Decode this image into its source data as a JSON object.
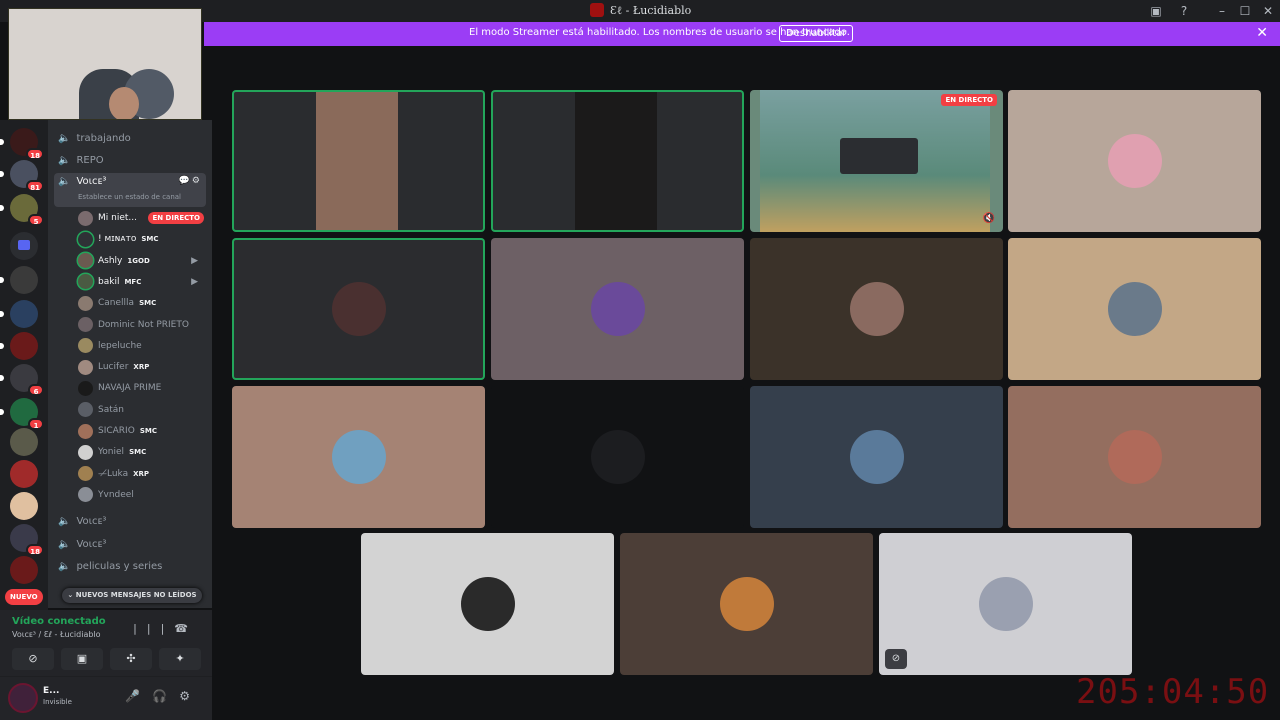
{
  "window": {
    "title": "Ɛℓ - Łucidiablo"
  },
  "banner": {
    "message": "El modo Streamer está habilitado. Los nombres de usuario se han truncado.",
    "button": "Deshabilitar"
  },
  "servers": {
    "badges": [
      "18",
      "81",
      "5",
      "6",
      "1",
      "18"
    ],
    "new_label": "NUEVO"
  },
  "channels": {
    "items": [
      {
        "label": "trabajando"
      },
      {
        "label": "REPO"
      }
    ],
    "active": {
      "label": "Voιcᴇ³",
      "status": "Establece un estado de canal"
    },
    "after": [
      {
        "label": "Voιcᴇ³"
      },
      {
        "label": "Voιcᴇ³"
      },
      {
        "label": "peliculas y series"
      }
    ],
    "members": [
      {
        "name": "Mi niet...",
        "tag": "",
        "live": "EN DIRECTO",
        "color": "#7a6b6e",
        "speaking": false
      },
      {
        "name": "! ᴍɪɴᴀᴛᴏ",
        "tag": "SMC",
        "color": "#2f3136",
        "speaking": true
      },
      {
        "name": "Ashly",
        "tag": "1GOD",
        "color": "#6b5a50",
        "speaking": true
      },
      {
        "name": "bakil",
        "tag": "MFC",
        "color": "#4a5a42",
        "speaking": true
      },
      {
        "name": "Canellla",
        "tag": "SMC",
        "color": "#8a7a70",
        "speaking": false
      },
      {
        "name": "Dominic Not PRIETO",
        "tag": "",
        "color": "#6b6064",
        "speaking": false
      },
      {
        "name": "lepeluche",
        "tag": "",
        "color": "#9a8a60",
        "speaking": false
      },
      {
        "name": "Lucifer",
        "tag": "XRP",
        "color": "#a08a80",
        "speaking": false
      },
      {
        "name": "NAVAJA PRIME",
        "tag": "",
        "color": "#1a1a1a",
        "speaking": false
      },
      {
        "name": "Satán",
        "tag": "",
        "color": "#5a5e66",
        "speaking": false
      },
      {
        "name": "SICARIO",
        "tag": "SMC",
        "color": "#a0705a",
        "speaking": false
      },
      {
        "name": "Yoniel",
        "tag": "SMC",
        "color": "#d0d0d0",
        "speaking": false
      },
      {
        "name": "—̸Luka",
        "tag": "XRP",
        "color": "#a08050",
        "speaking": false
      },
      {
        "name": "Yvndeel",
        "tag": "",
        "color": "#8a8e96",
        "speaking": false
      }
    ],
    "unread_label": "NUEVOS MENSAJES NO LEÍDOS"
  },
  "voice": {
    "connected": "Vídeo conectado",
    "path": "Voιcᴇ³ / Ɛℓ - Łucidiablo"
  },
  "user": {
    "name": "E...",
    "status": "Invisible"
  },
  "grid": {
    "live_label": "EN DIRECTO",
    "tiles": [
      {
        "kind": "video",
        "bg": "#2a2c2f",
        "speaking": true
      },
      {
        "kind": "video-dark",
        "bg": "#2a2c2f",
        "speaking": true
      },
      {
        "kind": "stream",
        "bg": "#6a8a7a",
        "speaking": false
      },
      {
        "kind": "avatar",
        "bg": "#b7a69a",
        "pfp": "#e0a0b0",
        "speaking": false
      },
      {
        "kind": "avatar",
        "bg": "#2b2c2f",
        "pfp": "#4a3030",
        "speaking": true
      },
      {
        "kind": "avatar",
        "bg": "#6d6065",
        "pfp": "#6a4a9a",
        "speaking": false
      },
      {
        "kind": "avatar",
        "bg": "#3b3229",
        "pfp": "#8a6a60",
        "speaking": false
      },
      {
        "kind": "avatar",
        "bg": "#c3a786",
        "pfp": "#6a7a8a",
        "speaking": false
      },
      {
        "kind": "avatar",
        "bg": "#a58374",
        "pfp": "#70a0c0",
        "speaking": false
      },
      {
        "kind": "avatar",
        "bg": "#111214",
        "pfp": "#1c1d20",
        "speaking": false
      },
      {
        "kind": "avatar",
        "bg": "#353f4c",
        "pfp": "#5a7a9a",
        "speaking": false
      },
      {
        "kind": "avatar",
        "bg": "#946e5f",
        "pfp": "#b06a5a",
        "speaking": false
      },
      {
        "kind": "avatar",
        "bg": "#d3d3d3",
        "pfp": "#2a2a2a",
        "speaking": false
      },
      {
        "kind": "avatar",
        "bg": "#4c3e37",
        "pfp": "#c07a3a",
        "speaking": false
      },
      {
        "kind": "avatar",
        "bg": "#cfcfd3",
        "pfp": "#9aa0b0",
        "speaking": false
      }
    ]
  },
  "timer": "205:04:50"
}
